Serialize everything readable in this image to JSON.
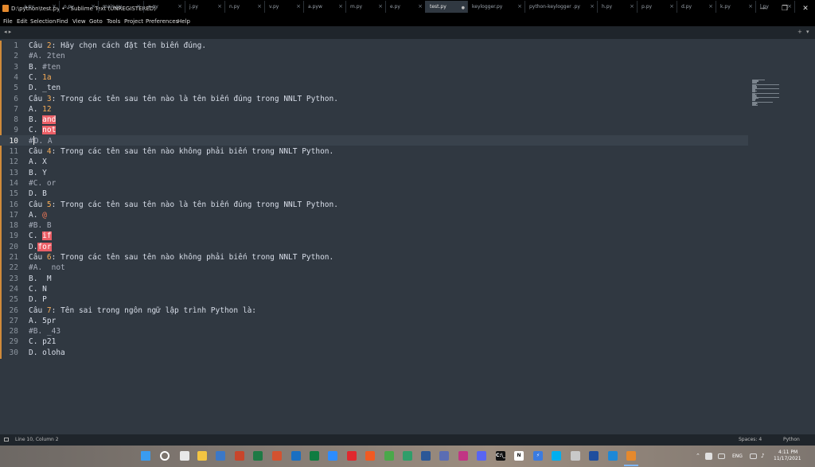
{
  "window": {
    "title": "D:\\python\\test.py • - Sublime Text (UNREGISTERED)",
    "minimize": "—",
    "maximize": "❐",
    "close": "✕"
  },
  "menu": [
    "File",
    "Edit",
    "Selection",
    "Find",
    "View",
    "Goto",
    "Tools",
    "Project",
    "Preferences",
    "Help"
  ],
  "tabs": [
    "a.py",
    "o.py",
    "main.py",
    "x.py",
    "j.py",
    "n.py",
    "v.py",
    "a.pyw",
    "m.py",
    "e.py",
    "test.py",
    "keylogger.py",
    "python-keylogger .py",
    "h.py",
    "p.py",
    "d.py",
    "k.py",
    "l.py"
  ],
  "active_tab_index": 10,
  "tab_nav": {
    "left": "◂ ▸",
    "add": "+",
    "menu": "▾"
  },
  "editor": {
    "current_line": 10,
    "lines": [
      {
        "n": "1",
        "segs": [
          [
            "tx",
            "Câu "
          ],
          [
            "nu",
            "2"
          ],
          [
            "tx",
            ": Hãy chọn cách đặt tên biến đúng."
          ]
        ]
      },
      {
        "n": "2",
        "segs": [
          [
            "cm",
            "#A. 2ten"
          ]
        ]
      },
      {
        "n": "3",
        "segs": [
          [
            "tx",
            "B. "
          ],
          [
            "cm",
            "#ten"
          ]
        ]
      },
      {
        "n": "4",
        "segs": [
          [
            "tx",
            "C. "
          ],
          [
            "nu",
            "1a"
          ]
        ]
      },
      {
        "n": "5",
        "segs": [
          [
            "tx",
            "D. _ten"
          ]
        ]
      },
      {
        "n": "6",
        "segs": [
          [
            "tx",
            "Câu "
          ],
          [
            "nu",
            "3"
          ],
          [
            "tx",
            ": Trong các tên sau tên nào là tên biến đúng trong NNLT Python."
          ]
        ]
      },
      {
        "n": "7",
        "segs": [
          [
            "tx",
            "A. "
          ],
          [
            "nu",
            "12"
          ]
        ]
      },
      {
        "n": "8",
        "segs": [
          [
            "tx",
            "B. "
          ],
          [
            "kw",
            "and"
          ]
        ]
      },
      {
        "n": "9",
        "segs": [
          [
            "tx",
            "C. "
          ],
          [
            "kw",
            "not"
          ]
        ]
      },
      {
        "n": "10",
        "segs": [
          [
            "cm",
            "#"
          ],
          [
            "caret",
            ""
          ],
          [
            "cm",
            "D. A"
          ]
        ]
      },
      {
        "n": "11",
        "segs": [
          [
            "tx",
            "Câu "
          ],
          [
            "nu",
            "4"
          ],
          [
            "tx",
            ": Trong các tên sau tên nào không phải biến trong NNLT Python."
          ]
        ]
      },
      {
        "n": "12",
        "segs": [
          [
            "tx",
            "A. X"
          ]
        ]
      },
      {
        "n": "13",
        "segs": [
          [
            "tx",
            "B. Y"
          ]
        ]
      },
      {
        "n": "14",
        "segs": [
          [
            "cm",
            "#C. or"
          ]
        ]
      },
      {
        "n": "15",
        "segs": [
          [
            "tx",
            "D. B"
          ]
        ]
      },
      {
        "n": "16",
        "segs": [
          [
            "tx",
            "Câu "
          ],
          [
            "nu",
            "5"
          ],
          [
            "tx",
            ": Trong các tên sau tên nào là tên biến đúng trong NNLT Python."
          ]
        ]
      },
      {
        "n": "17",
        "segs": [
          [
            "tx",
            "A. "
          ],
          [
            "sy",
            "@"
          ]
        ]
      },
      {
        "n": "18",
        "segs": [
          [
            "cm",
            "#B. B"
          ]
        ]
      },
      {
        "n": "19",
        "segs": [
          [
            "tx",
            "C. "
          ],
          [
            "kw",
            "if"
          ]
        ]
      },
      {
        "n": "20",
        "segs": [
          [
            "tx",
            "D."
          ],
          [
            "kw",
            "for"
          ]
        ]
      },
      {
        "n": "21",
        "segs": [
          [
            "tx",
            "Câu "
          ],
          [
            "nu",
            "6"
          ],
          [
            "tx",
            ": Trong các tên sau tên nào không phải biến trong NNLT Python."
          ]
        ]
      },
      {
        "n": "22",
        "segs": [
          [
            "cm",
            "#A.  not"
          ]
        ]
      },
      {
        "n": "23",
        "segs": [
          [
            "tx",
            "B.  M"
          ]
        ]
      },
      {
        "n": "24",
        "segs": [
          [
            "tx",
            "C. N"
          ]
        ]
      },
      {
        "n": "25",
        "segs": [
          [
            "tx",
            "D. P"
          ]
        ]
      },
      {
        "n": "26",
        "segs": [
          [
            "tx",
            "Câu "
          ],
          [
            "nu",
            "7"
          ],
          [
            "tx",
            ": Tên sai trong ngôn ngữ lập trình Python là:"
          ]
        ]
      },
      {
        "n": "27",
        "segs": [
          [
            "tx",
            "A. 5pr"
          ]
        ]
      },
      {
        "n": "28",
        "segs": [
          [
            "cm",
            "#B. _43"
          ]
        ]
      },
      {
        "n": "29",
        "segs": [
          [
            "tx",
            "C. p21"
          ]
        ]
      },
      {
        "n": "30",
        "segs": [
          [
            "tx",
            "D. oloha"
          ]
        ]
      }
    ]
  },
  "status": {
    "position": "Line 10, Column 2",
    "spaces": "Spaces: 4",
    "syntax": "Python"
  },
  "taskbar": {
    "lang": "ENG",
    "time": "4:11 PM",
    "date": "11/17/2021",
    "icon_labels": [
      [
        "cmd",
        "C:\\_"
      ],
      [
        "notion",
        "N"
      ],
      [
        "messenger",
        "⚡"
      ]
    ],
    "icons": [
      {
        "name": "windows-start-icon",
        "color": "#3a9cf0"
      },
      {
        "name": "search-icon",
        "color": "#ffffff"
      },
      {
        "name": "task-view-icon",
        "color": "#e8e8e8"
      },
      {
        "name": "file-explorer-icon",
        "color": "#f4c542"
      },
      {
        "name": "folder-icon",
        "color": "#3b78c7"
      },
      {
        "name": "powerpoint-icon",
        "color": "#c8452b"
      },
      {
        "name": "excel-icon",
        "color": "#1e7a45"
      },
      {
        "name": "powerpoint-alt-icon",
        "color": "#d35230"
      },
      {
        "name": "outlook-icon",
        "color": "#1a6fc2"
      },
      {
        "name": "excel-alt-icon",
        "color": "#107c41"
      },
      {
        "name": "zoom-icon",
        "color": "#2d8cff"
      },
      {
        "name": "opera-icon",
        "color": "#e0282e"
      },
      {
        "name": "brave-icon",
        "color": "#f15a22"
      },
      {
        "name": "chrome-icon",
        "color": "#4aa84a"
      },
      {
        "name": "chrome-beta-icon",
        "color": "#2f9e6a"
      },
      {
        "name": "word-icon",
        "color": "#2b5797"
      },
      {
        "name": "photos-icon",
        "color": "#5b6db3"
      },
      {
        "name": "instagram-icon",
        "color": "#c13584"
      },
      {
        "name": "discord-icon",
        "color": "#5865f2"
      },
      {
        "name": "cmd-icon",
        "color": "#111111"
      },
      {
        "name": "notion-icon",
        "color": "#ffffff"
      },
      {
        "name": "messenger-icon",
        "color": "#3a7be0"
      },
      {
        "name": "skype-icon",
        "color": "#00aff0"
      },
      {
        "name": "settings-icon",
        "color": "#c9c9c9"
      },
      {
        "name": "word-app-icon",
        "color": "#1f4e9e"
      },
      {
        "name": "vscode-icon",
        "color": "#1e88d6"
      },
      {
        "name": "sublime-text-icon",
        "color": "#e5892d"
      }
    ]
  }
}
